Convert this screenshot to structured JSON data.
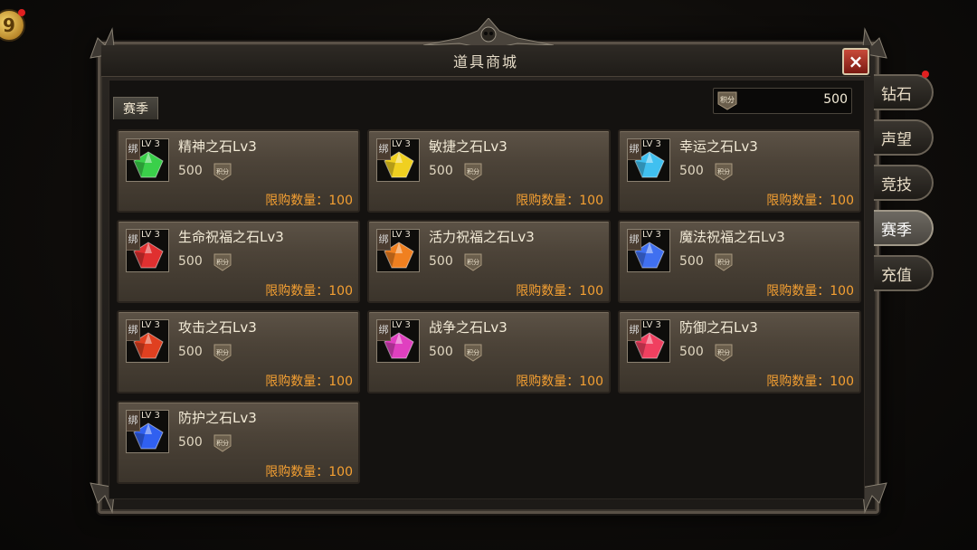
{
  "corner_badge": "9",
  "window": {
    "title": "道具商城",
    "close_label": "×"
  },
  "filter_label": "赛季",
  "points": {
    "icon_label": "积分",
    "value": "500"
  },
  "currency_label": "积分",
  "bind_label": "绑",
  "items": [
    {
      "name": "精神之石Lv3",
      "level": "LV 3",
      "price": "500",
      "limit": "限购数量：100",
      "gem_color": "#3ad04a"
    },
    {
      "name": "敏捷之石Lv3",
      "level": "LV 3",
      "price": "500",
      "limit": "限购数量：100",
      "gem_color": "#f0d020"
    },
    {
      "name": "幸运之石Lv3",
      "level": "LV 3",
      "price": "500",
      "limit": "限购数量：100",
      "gem_color": "#40c0f0"
    },
    {
      "name": "生命祝福之石Lv3",
      "level": "LV 3",
      "price": "500",
      "limit": "限购数量：100",
      "gem_color": "#e03030"
    },
    {
      "name": "活力祝福之石Lv3",
      "level": "LV 3",
      "price": "500",
      "limit": "限购数量：100",
      "gem_color": "#f08020"
    },
    {
      "name": "魔法祝福之石Lv3",
      "level": "LV 3",
      "price": "500",
      "limit": "限购数量：100",
      "gem_color": "#4070f0"
    },
    {
      "name": "攻击之石Lv3",
      "level": "LV 3",
      "price": "500",
      "limit": "限购数量：100",
      "gem_color": "#e04020"
    },
    {
      "name": "战争之石Lv3",
      "level": "LV 3",
      "price": "500",
      "limit": "限购数量：100",
      "gem_color": "#e040c0"
    },
    {
      "name": "防御之石Lv3",
      "level": "LV 3",
      "price": "500",
      "limit": "限购数量：100",
      "gem_color": "#f04060"
    },
    {
      "name": "防护之石Lv3",
      "level": "LV 3",
      "price": "500",
      "limit": "限购数量：100",
      "gem_color": "#3060f0"
    }
  ],
  "tabs": [
    {
      "label": "钻石",
      "active": false,
      "has_notice": true
    },
    {
      "label": "声望",
      "active": false,
      "has_notice": false
    },
    {
      "label": "竞技",
      "active": false,
      "has_notice": false
    },
    {
      "label": "赛季",
      "active": true,
      "has_notice": false
    },
    {
      "label": "充值",
      "active": false,
      "has_notice": false
    }
  ]
}
